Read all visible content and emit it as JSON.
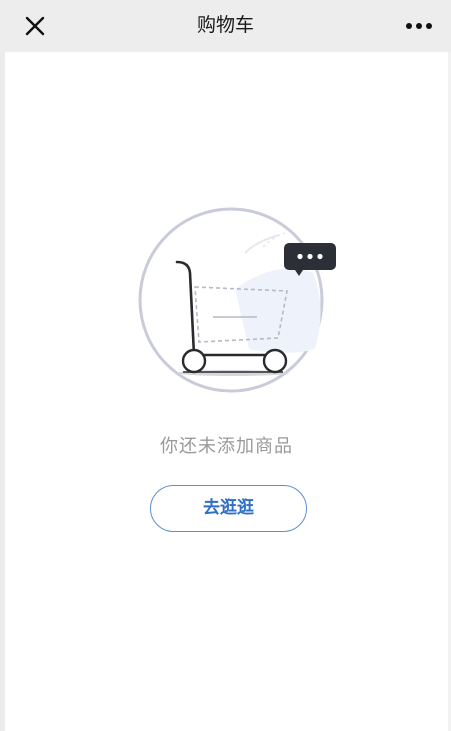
{
  "header": {
    "title": "购物车",
    "close_icon": "close-icon",
    "more_icon": "more-dots-icon"
  },
  "empty_state": {
    "illustration_icon": "empty-cart-icon",
    "bubble_icon": "chat-bubble-icon",
    "message": "你还未添加商品",
    "button_label": "去逛逛"
  },
  "colors": {
    "nav_background": "#ededed",
    "accent": "#2f6fc4",
    "button_border": "#5b8fd6",
    "muted_text": "#9a9a9a"
  }
}
